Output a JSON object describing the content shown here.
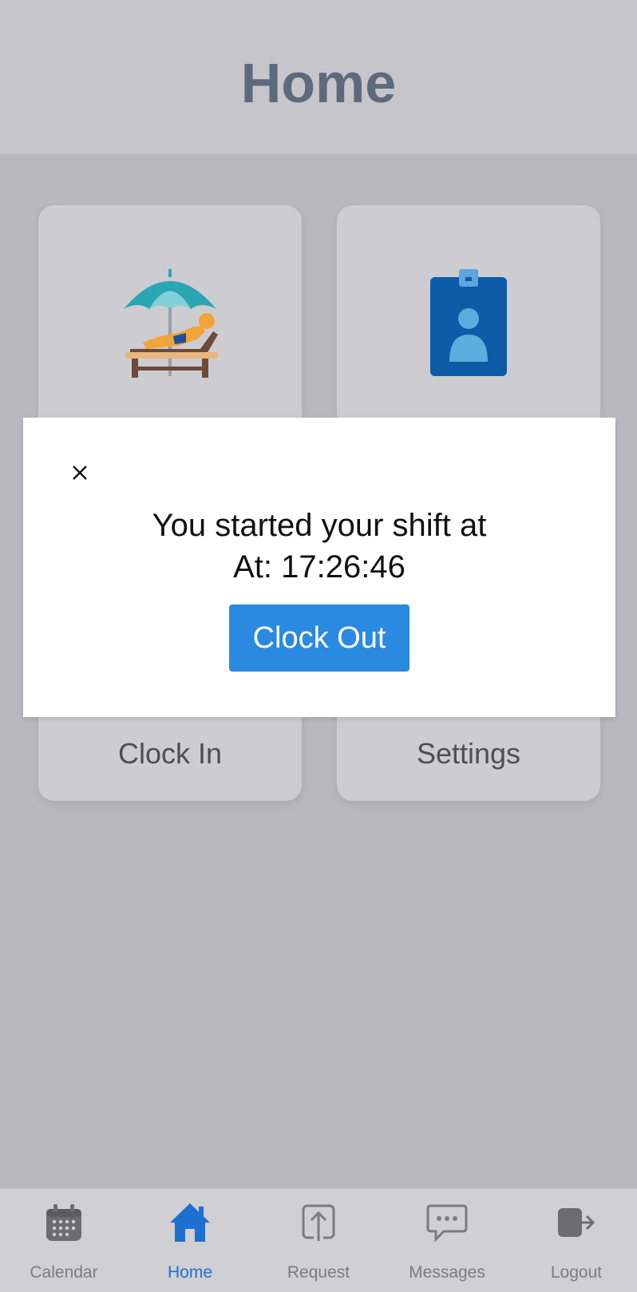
{
  "header": {
    "title": "Home"
  },
  "tiles": [
    {
      "label": "Clock In",
      "icon": "beach-umbrella-lounger-icon"
    },
    {
      "label": "Settings",
      "icon": "id-badge-icon"
    }
  ],
  "modal": {
    "close_icon": "close-icon",
    "message_line1": "You started your shift at",
    "message_line2": "At: 17:26:46",
    "button_label": "Clock Out"
  },
  "tabbar": {
    "active": "Home",
    "items": [
      {
        "label": "Calendar",
        "icon": "calendar-icon"
      },
      {
        "label": "Home",
        "icon": "home-icon"
      },
      {
        "label": "Request",
        "icon": "upload-icon"
      },
      {
        "label": "Messages",
        "icon": "chat-icon"
      },
      {
        "label": "Logout",
        "icon": "logout-icon"
      }
    ]
  },
  "colors": {
    "accent": "#2a8ae0",
    "active_tab": "#1e6fd0",
    "title": "#5d6a7d",
    "overlay_bg": "#b9b8bd"
  }
}
